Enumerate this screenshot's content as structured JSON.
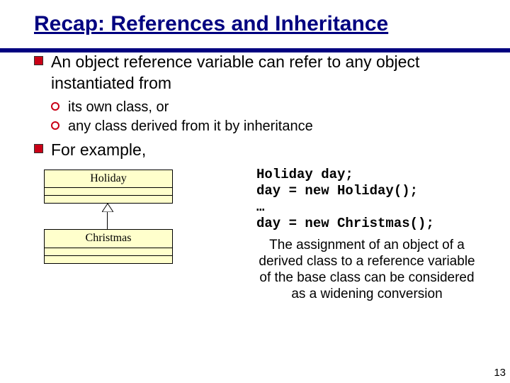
{
  "title": "Recap: References and Inheritance",
  "bullets": {
    "b1a": "An object reference variable can refer to any object instantiated from",
    "b2a": "its own class, or",
    "b2b": "any class derived from it by inheritance",
    "b1b": "For example,"
  },
  "uml": {
    "class1": "Holiday",
    "class2": "Christmas"
  },
  "code_lines": {
    "l1": "Holiday day;",
    "l2": "day = new Holiday();",
    "l3": "…",
    "l4": "day = new Christmas();"
  },
  "note": "The assignment of an object of a derived class to a reference variable of the base class can be considered as a widening conversion",
  "page_number": "13"
}
